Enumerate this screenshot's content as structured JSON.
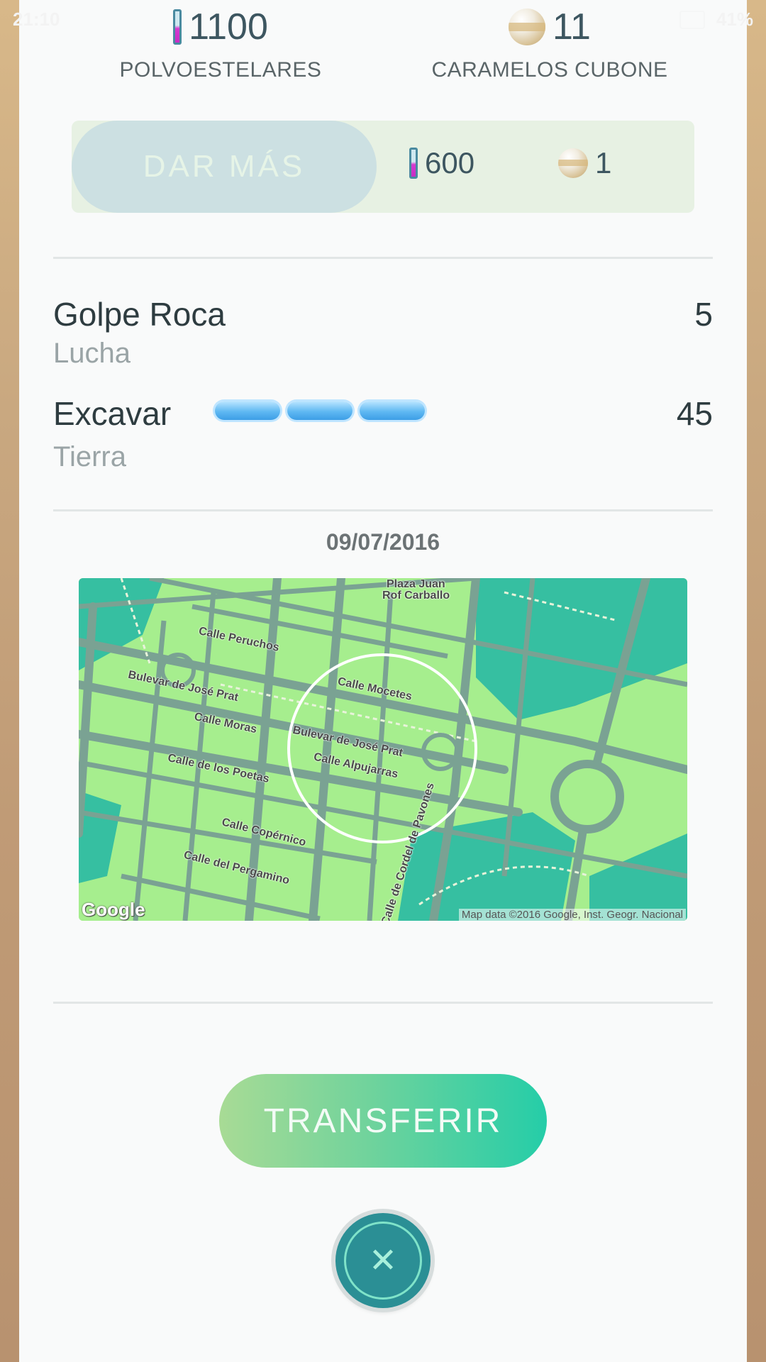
{
  "status_bar": {
    "time": "21:10",
    "battery": "41%"
  },
  "resources": {
    "stardust": {
      "value": "1100",
      "label": "POLVOESTELARES",
      "icon": "stardust-icon"
    },
    "candy": {
      "value": "11",
      "label": "CARAMELOS CUBONE",
      "icon": "candy-icon"
    }
  },
  "power_up": {
    "button_label": "DAR MÁS",
    "stardust_cost": "600",
    "candy_cost": "1"
  },
  "moves": [
    {
      "name": "Golpe Roca",
      "type": "Lucha",
      "power": "5"
    },
    {
      "name": "Excavar",
      "type": "Tierra",
      "power": "45",
      "energy_bars": 3
    }
  ],
  "capture": {
    "date": "09/07/2016",
    "map": {
      "streets": [
        "Plaza Juan",
        "Rof Carballo",
        "Calle Peruchos",
        "Bulevar de José Prat",
        "Calle Mocetes",
        "Calle Moras",
        "Bulevar de José Prat",
        "Calle Alpujarras",
        "Calle de los Poetas",
        "Calle Copérnico",
        "Calle del Pergamino",
        "Calle de Cordel de Pavones"
      ],
      "logo": "Google",
      "attribution": "Map data ©2016 Google, Inst. Geogr. Nacional"
    }
  },
  "transfer_label": "TRANSFERIR",
  "colors": {
    "accent_teal": "#25cda8",
    "map_green": "#a6ee8e",
    "text_dark": "#2e3c40"
  }
}
